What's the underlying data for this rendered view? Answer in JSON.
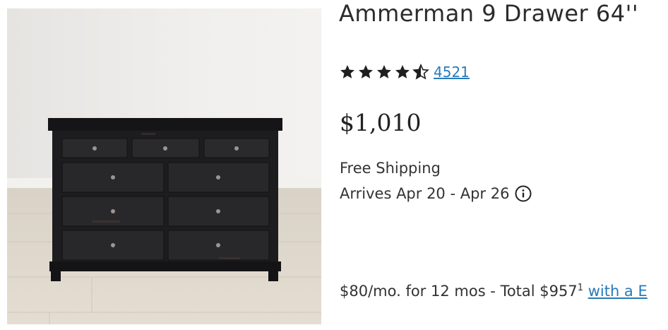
{
  "product": {
    "title": "Ammerman 9 Drawer 64''",
    "image_alt": "dresser-photo",
    "rating": {
      "value": 4.5,
      "max": 5,
      "review_count": "4521"
    },
    "price": "$1,010",
    "shipping": "Free Shipping",
    "arrival": "Arrives Apr 20 - Apr 26",
    "financing": {
      "text": "$80/mo. for 12 mos - Total $957",
      "footnote": "1",
      "link_text": "with a E"
    }
  },
  "colors": {
    "link": "#2a7ab8",
    "text": "#333333",
    "star": "#1f1f1f",
    "dresser": "#1c1c1e"
  }
}
